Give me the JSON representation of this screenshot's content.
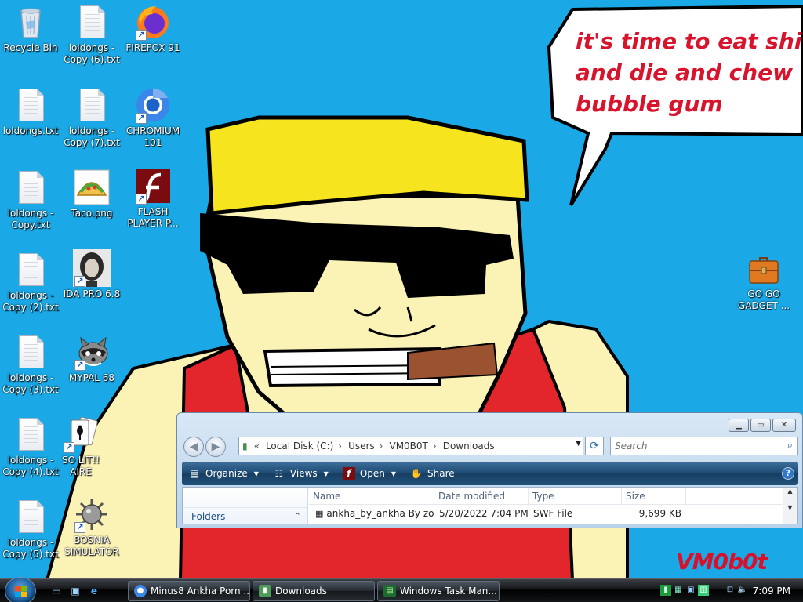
{
  "wallpaper": {
    "speech_bubble": [
      "it's time to eat shit",
      "and die and chew",
      "bubble gum"
    ],
    "watermark": "VM0b0t"
  },
  "desktop_icons": [
    {
      "label": "Recycle Bin",
      "icon": "recycle-bin-icon"
    },
    {
      "label": "loldongs - Copy (6).txt",
      "icon": "text-file-icon"
    },
    {
      "label": "FIREFOX 91",
      "icon": "firefox-icon"
    },
    {
      "label": "loldongs.txt",
      "icon": "text-file-icon"
    },
    {
      "label": "loldongs - Copy (7).txt",
      "icon": "text-file-icon"
    },
    {
      "label": "CHROMIUM 101",
      "icon": "chromium-icon"
    },
    {
      "label": "loldongs - Copy.txt",
      "icon": "text-file-icon"
    },
    {
      "label": "Taco.png",
      "icon": "taco-image-icon"
    },
    {
      "label": "FLASH PLAYER P...",
      "icon": "flash-player-icon"
    },
    {
      "label": "loldongs - Copy (2).txt",
      "icon": "text-file-icon"
    },
    {
      "label": "IDA PRO 6.8",
      "icon": "ida-pro-icon"
    },
    {
      "label": "loldongs - Copy (3).txt",
      "icon": "text-file-icon"
    },
    {
      "label": "MYPAL 68",
      "icon": "mypal-raccoon-icon"
    },
    {
      "label": "loldongs - Copy (4).txt",
      "icon": "text-file-icon"
    },
    {
      "label": "SO LIT!! AIRE",
      "icon": "solitaire-cards-icon"
    },
    {
      "label": "loldongs - Copy (5).txt",
      "icon": "text-file-icon"
    },
    {
      "label": "BOSNIA SIMULATOR",
      "icon": "spiked-mine-icon"
    },
    {
      "label": "GO GO GADGET ...",
      "icon": "briefcase-icon"
    }
  ],
  "explorer": {
    "breadcrumb": [
      "Local Disk (C:)",
      "Users",
      "VM0B0T",
      "Downloads"
    ],
    "search_placeholder": "Search",
    "commands": {
      "organize": "Organize",
      "views": "Views",
      "open": "Open",
      "share": "Share"
    },
    "nav_pane": {
      "folders_label": "Folders"
    },
    "columns": [
      "Name",
      "Date modified",
      "Type",
      "Size"
    ],
    "files": [
      {
        "name": "ankha_by_ankha By zo...",
        "date_modified": "5/20/2022 7:04 PM",
        "type": "SWF File",
        "size": "9,699 KB"
      }
    ]
  },
  "taskbar": {
    "buttons": [
      {
        "label": "Minus8 Ankha Porn ...",
        "icon": "chromium-icon"
      },
      {
        "label": "Downloads",
        "icon": "folder-icon"
      },
      {
        "label": "Windows Task Man...",
        "icon": "task-manager-icon"
      }
    ],
    "clock": "7:09 PM"
  },
  "colors": {
    "desktop_bg": "#1aa9e6",
    "bubble_text": "#d8142c",
    "command_bar": "#1c4a73"
  }
}
